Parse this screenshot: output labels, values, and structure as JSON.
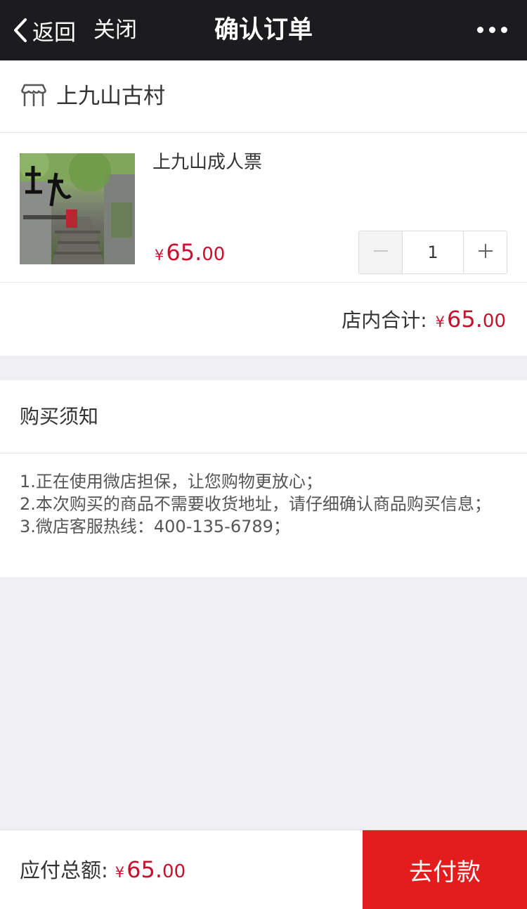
{
  "navbar": {
    "back_label": "返回",
    "close_label": "关闭",
    "title": "确认订单",
    "more_icon": "more-dots-icon",
    "back_icon": "chevron-left-icon"
  },
  "shop": {
    "icon": "storefront-icon",
    "name": "上九山古村"
  },
  "item": {
    "title": "上九山成人票",
    "thumbnail_icon": "product-thumbnail",
    "price": {
      "currency": "¥",
      "integer": "65.",
      "decimal": "00"
    },
    "quantity": "1"
  },
  "shop_total": {
    "label": "店内合计:",
    "price": {
      "currency": "¥",
      "integer": "65.",
      "decimal": "00"
    }
  },
  "notice": {
    "title": "购买须知",
    "lines": [
      "1.正在使用微店担保，让您购物更放心；",
      "2.本次购买的商品不需要收货地址，请仔细确认商品购买信息；",
      "3.微店客服热线：400-135-6789；"
    ]
  },
  "bottom": {
    "label": "应付总额:",
    "price": {
      "currency": "¥",
      "integer": "65.",
      "decimal": "00"
    },
    "pay_button": "去付款"
  },
  "colors": {
    "navbar_bg": "#1c1c1e",
    "accent_red": "#c8102e",
    "pay_button_bg": "#e31d1d",
    "page_bg": "#efeff4"
  }
}
